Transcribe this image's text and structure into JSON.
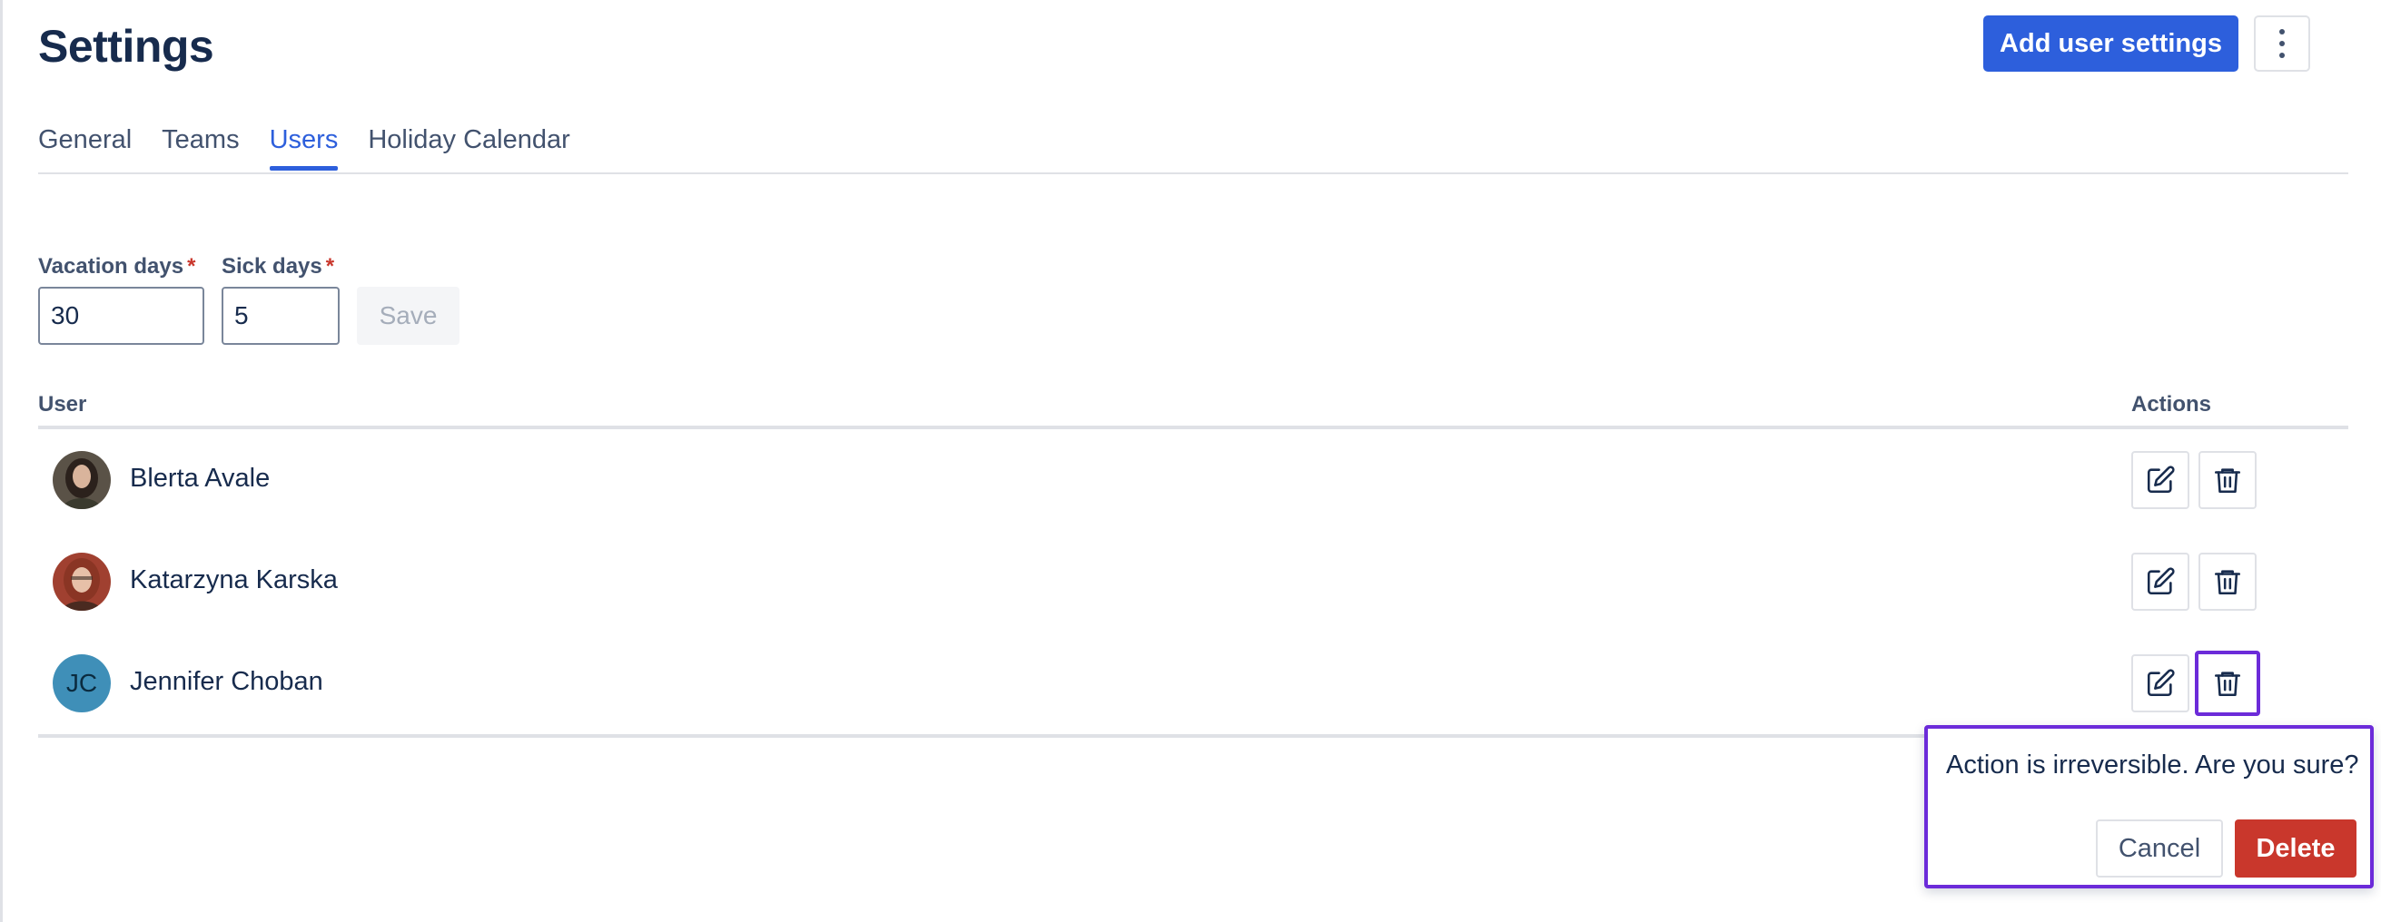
{
  "header": {
    "title": "Settings",
    "add_button_label": "Add user settings",
    "more_icon": "more-vertical-icon"
  },
  "tabs": [
    {
      "label": "General",
      "active": false
    },
    {
      "label": "Teams",
      "active": false
    },
    {
      "label": "Users",
      "active": true
    },
    {
      "label": "Holiday Calendar",
      "active": false
    }
  ],
  "form": {
    "vacation_label": "Vacation days",
    "vacation_value": "30",
    "sick_label": "Sick days",
    "sick_value": "5",
    "required_marker": "*",
    "save_label": "Save"
  },
  "table": {
    "col_user": "User",
    "col_actions": "Actions",
    "rows": [
      {
        "name": "Blerta Avale",
        "avatar": "photo"
      },
      {
        "name": "Katarzyna Karska",
        "avatar": "photo"
      },
      {
        "name": "Jennifer Choban",
        "avatar_initials": "JC"
      }
    ]
  },
  "confirm": {
    "message": "Action is irreversible. Are you sure?",
    "cancel_label": "Cancel",
    "delete_label": "Delete"
  },
  "colors": {
    "primary": "#2d5fdc",
    "danger": "#c9372c",
    "focus_ring": "#6c2bd9",
    "avatar_initials_bg": "#3f8fb8"
  }
}
